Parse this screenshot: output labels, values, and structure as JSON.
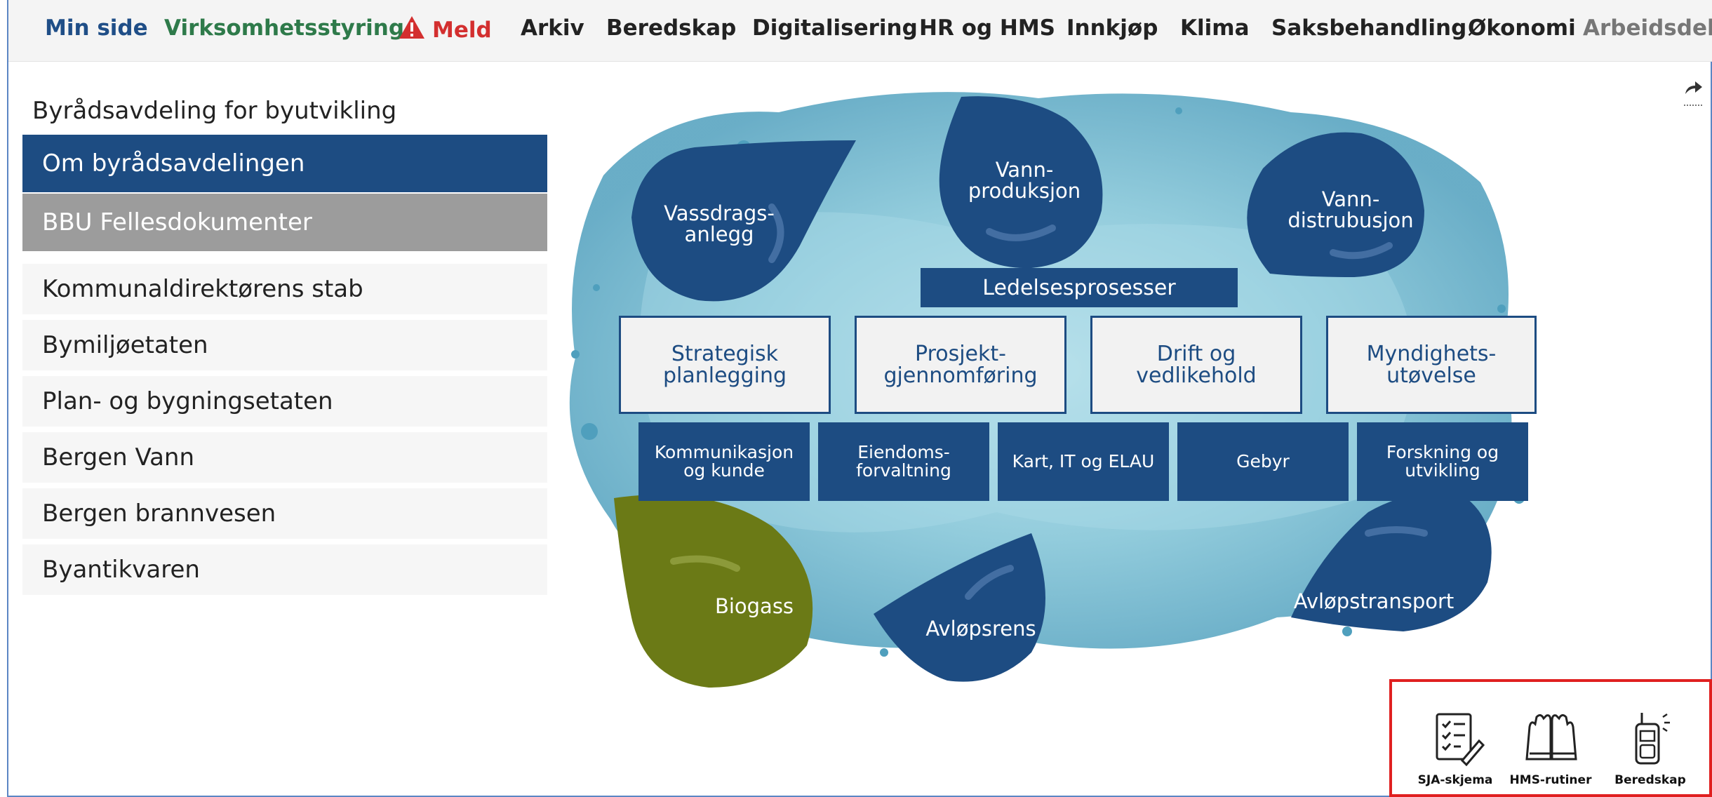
{
  "nav": {
    "home": "Min side",
    "governance": "Virksomhetsstyring",
    "report": "Meld",
    "archive": "Arkiv",
    "preparedness": "Beredskap",
    "digitalization": "Digitalisering",
    "hr": "HR og HMS",
    "procurement": "Innkjøp",
    "climate": "Klima",
    "casework": "Saksbehandling",
    "economy": "Økonomi",
    "workspace": "Arbeidsdel"
  },
  "sidebar": {
    "title": "Byrådsavdeling for byutvikling",
    "items": [
      {
        "label": "Om byrådsavdelingen"
      },
      {
        "label": "BBU Fellesdokumenter"
      },
      {
        "label": "Kommunaldirektørens stab"
      },
      {
        "label": "Bymiljøetaten"
      },
      {
        "label": "Plan- og bygningsetaten"
      },
      {
        "label": "Bergen Vann"
      },
      {
        "label": "Bergen brannvesen"
      },
      {
        "label": "Byantikvaren"
      }
    ]
  },
  "diagram": {
    "drops": {
      "watercourse": "Vassdrags-\nanlegg",
      "production": "Vann-\nproduksjon",
      "distribution": "Vann-\ndistrubusjon",
      "biogas": "Biogass",
      "treatment": "Avløpsrens",
      "transport": "Avløpstransport"
    },
    "management": "Ledelsesprosesser",
    "core": [
      {
        "label": "Strategisk\nplanlegging"
      },
      {
        "label": "Prosjekt-\ngjennomføring"
      },
      {
        "label": "Drift og\nvedlikehold"
      },
      {
        "label": "Myndighets-\nutøvelse"
      }
    ],
    "support": [
      {
        "label": "Kommunikasjon\nog kunde"
      },
      {
        "label": "Eiendoms-\nforvaltning"
      },
      {
        "label": "Kart, IT og ELAU"
      },
      {
        "label": "Gebyr"
      },
      {
        "label": "Forskning og\nutvikling"
      }
    ],
    "colors": {
      "drop": "#1d4c82",
      "biogas": "#6b7a16",
      "splash": "#7fc3d6"
    }
  },
  "tools": {
    "sja": "SJA-skjema",
    "hms": "HMS-rutiner",
    "preparedness": "Beredskap"
  }
}
